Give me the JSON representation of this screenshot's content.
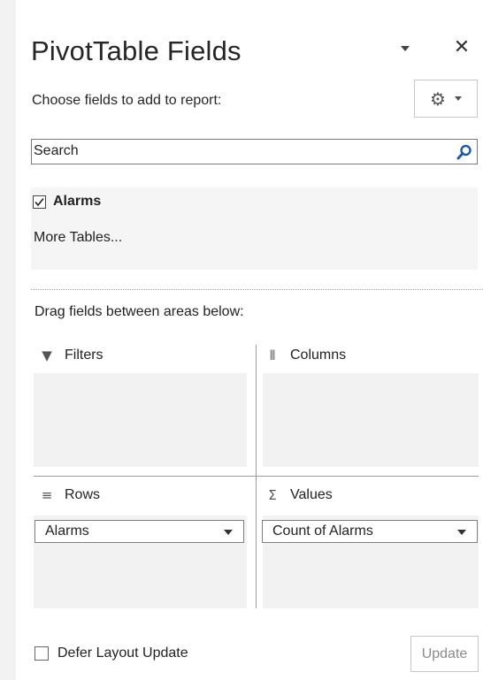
{
  "pane": {
    "title": "PivotTable Fields",
    "choose_label": "Choose fields to add to report:",
    "close_glyph": "✕"
  },
  "search": {
    "value": "Search",
    "icon": "search-icon"
  },
  "fields": [
    {
      "label": "Alarms",
      "checked": true
    }
  ],
  "more_tables": "More Tables...",
  "drag_label": "Drag fields between areas below:",
  "areas": {
    "filters": {
      "label": "Filters",
      "icon": "filter-icon",
      "glyph": "▼"
    },
    "columns": {
      "label": "Columns",
      "icon": "columns-icon",
      "glyph": "⦀"
    },
    "rows": {
      "label": "Rows",
      "icon": "rows-icon",
      "glyph": "≡",
      "items": [
        "Alarms"
      ]
    },
    "values": {
      "label": "Values",
      "icon": "sigma-icon",
      "glyph": "Σ",
      "items": [
        "Count of Alarms"
      ]
    }
  },
  "footer": {
    "defer_label": "Defer Layout Update",
    "defer_checked": false,
    "update_label": "Update"
  },
  "colors": {
    "zone_bg": "#f2f2f2",
    "panel_bg": "#f5f5f5",
    "search_icon": "#1e5aa8"
  }
}
